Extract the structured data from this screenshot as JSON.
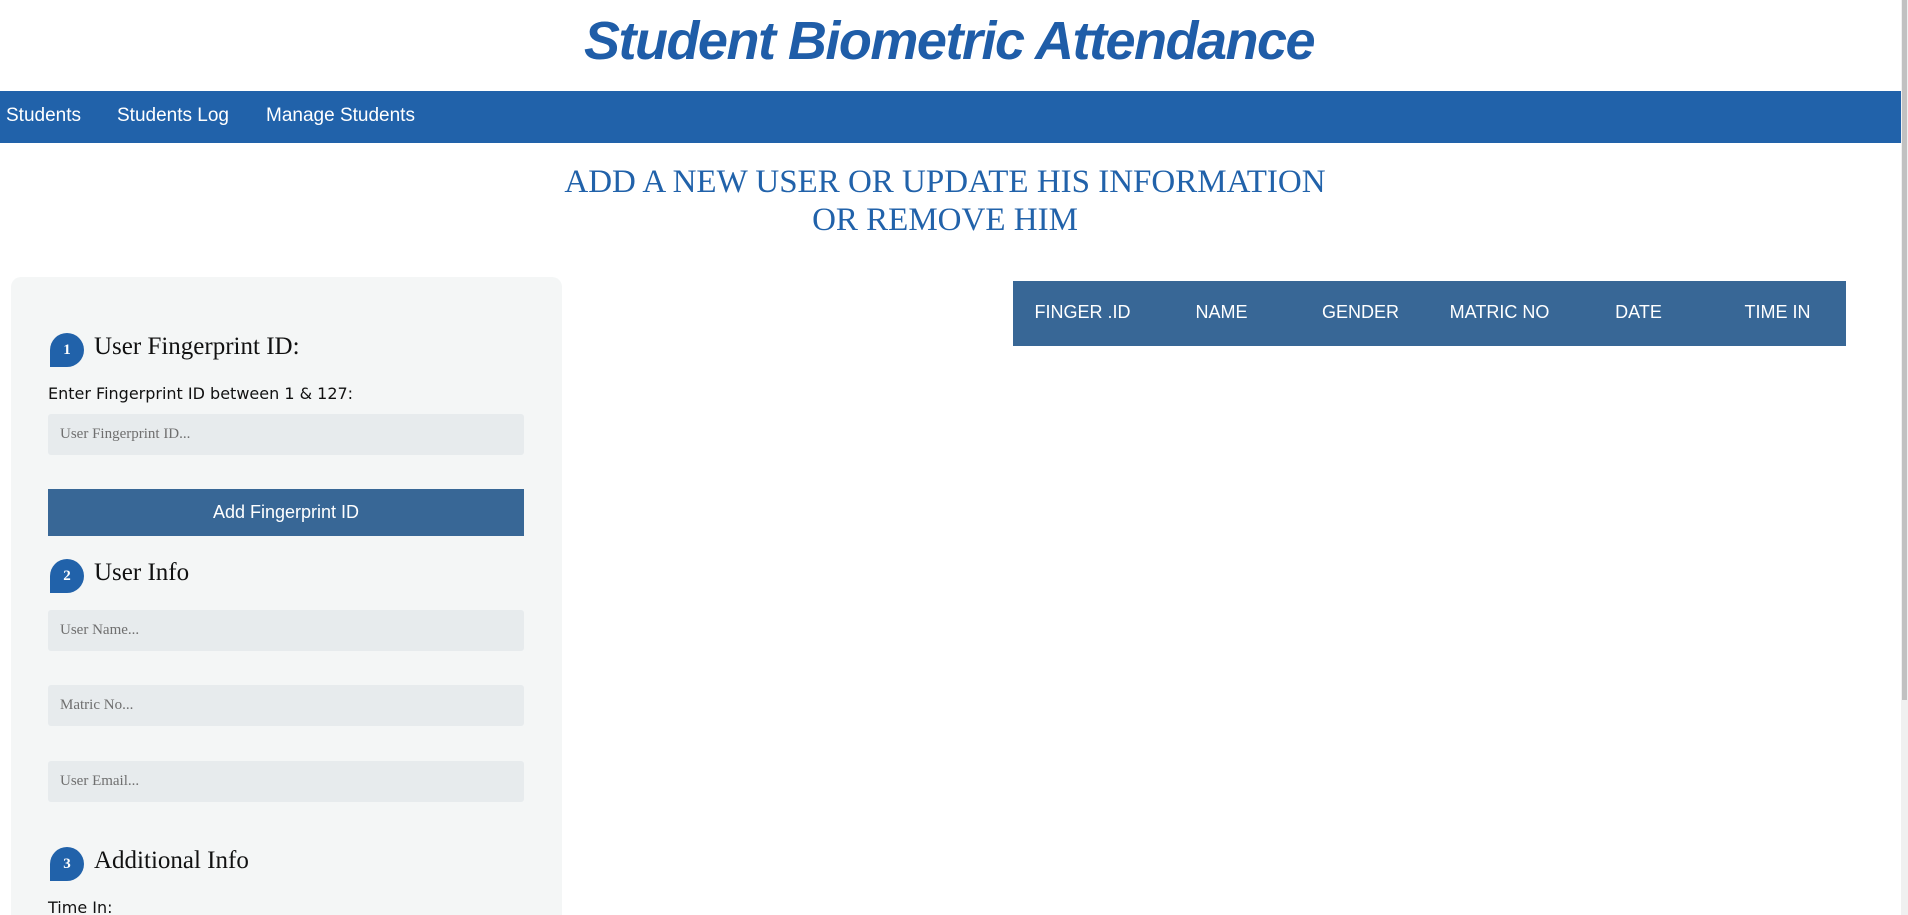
{
  "header": {
    "site_title": "Student Biometric Attendance"
  },
  "nav": {
    "items": [
      {
        "label": "Students"
      },
      {
        "label": "Students Log"
      },
      {
        "label": "Manage Students"
      }
    ]
  },
  "main": {
    "heading_line1": "ADD A NEW USER OR UPDATE HIS INFORMATION",
    "heading_line2": "OR REMOVE HIM"
  },
  "form": {
    "step1": {
      "number": "1",
      "title": "User Fingerprint ID:",
      "label": "Enter Fingerprint ID between 1 & 127:",
      "placeholder": "User Fingerprint ID...",
      "button_label": "Add Fingerprint ID"
    },
    "step2": {
      "number": "2",
      "title": "User Info",
      "name_placeholder": "User Name...",
      "matric_placeholder": "Matric No...",
      "email_placeholder": "User Email..."
    },
    "step3": {
      "number": "3",
      "title": "Additional Info",
      "time_in_label": "Time In:"
    }
  },
  "table": {
    "columns": [
      "FINGER .ID",
      "NAME",
      "GENDER",
      "MATRIC NO",
      "DATE",
      "TIME IN"
    ],
    "rows": []
  },
  "colors": {
    "brand_blue": "#2162aa",
    "table_header": "#386796",
    "panel_bg": "#f4f6f6",
    "input_bg": "#e7ebed"
  }
}
